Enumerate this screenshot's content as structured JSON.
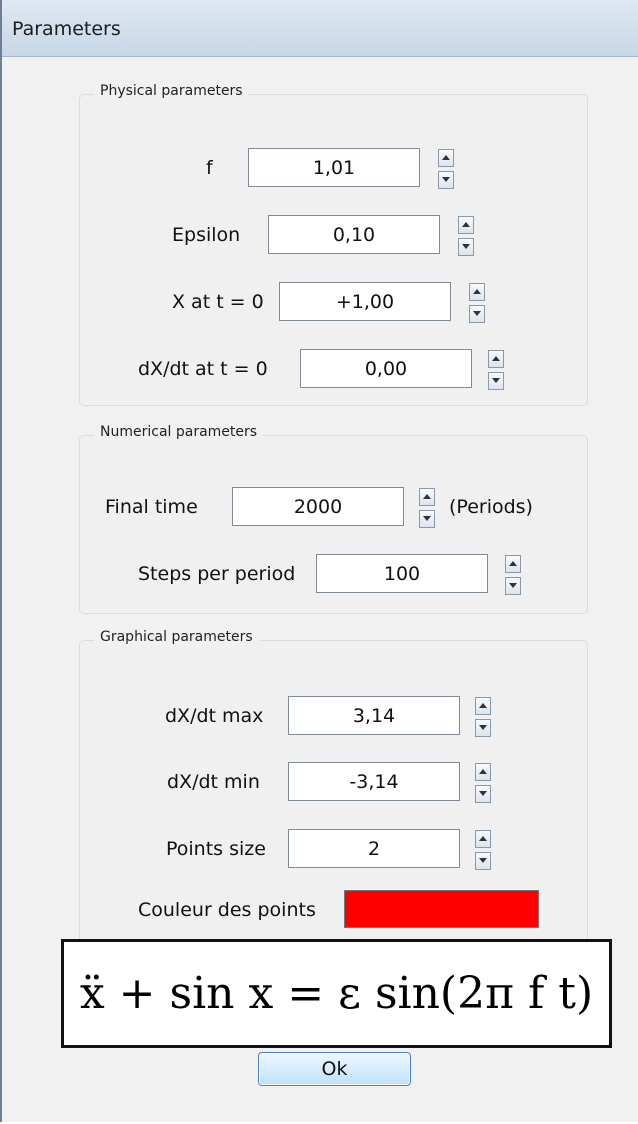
{
  "window": {
    "title": "Parameters"
  },
  "physical": {
    "group_label": "Physical parameters",
    "f_label": "f",
    "f_value": "1,01",
    "epsilon_label": "Epsilon",
    "epsilon_value": "0,10",
    "x0_label": "X at t = 0",
    "x0_value": "+1,00",
    "dxdt0_label": "dX/dt at t = 0",
    "dxdt0_value": "0,00"
  },
  "numerical": {
    "group_label": "Numerical parameters",
    "final_time_label": "Final time",
    "final_time_value": "2000",
    "final_time_unit": "(Periods)",
    "steps_label": "Steps per period",
    "steps_value": "100"
  },
  "graphical": {
    "group_label": "Graphical parameters",
    "dxdt_max_label": "dX/dt max",
    "dxdt_max_value": "3,14",
    "dxdt_min_label": "dX/dt min",
    "dxdt_min_value": "-3,14",
    "points_size_label": "Points size",
    "points_size_value": "2",
    "points_color_label": "Couleur des points",
    "points_color": "#ff0000"
  },
  "formula": {
    "text": "ẍ + sin x = ε sin(2π f t)"
  },
  "buttons": {
    "ok_label": "Ok"
  },
  "icons": {
    "spin_up": "chevron-up-icon",
    "spin_down": "chevron-down-icon"
  }
}
